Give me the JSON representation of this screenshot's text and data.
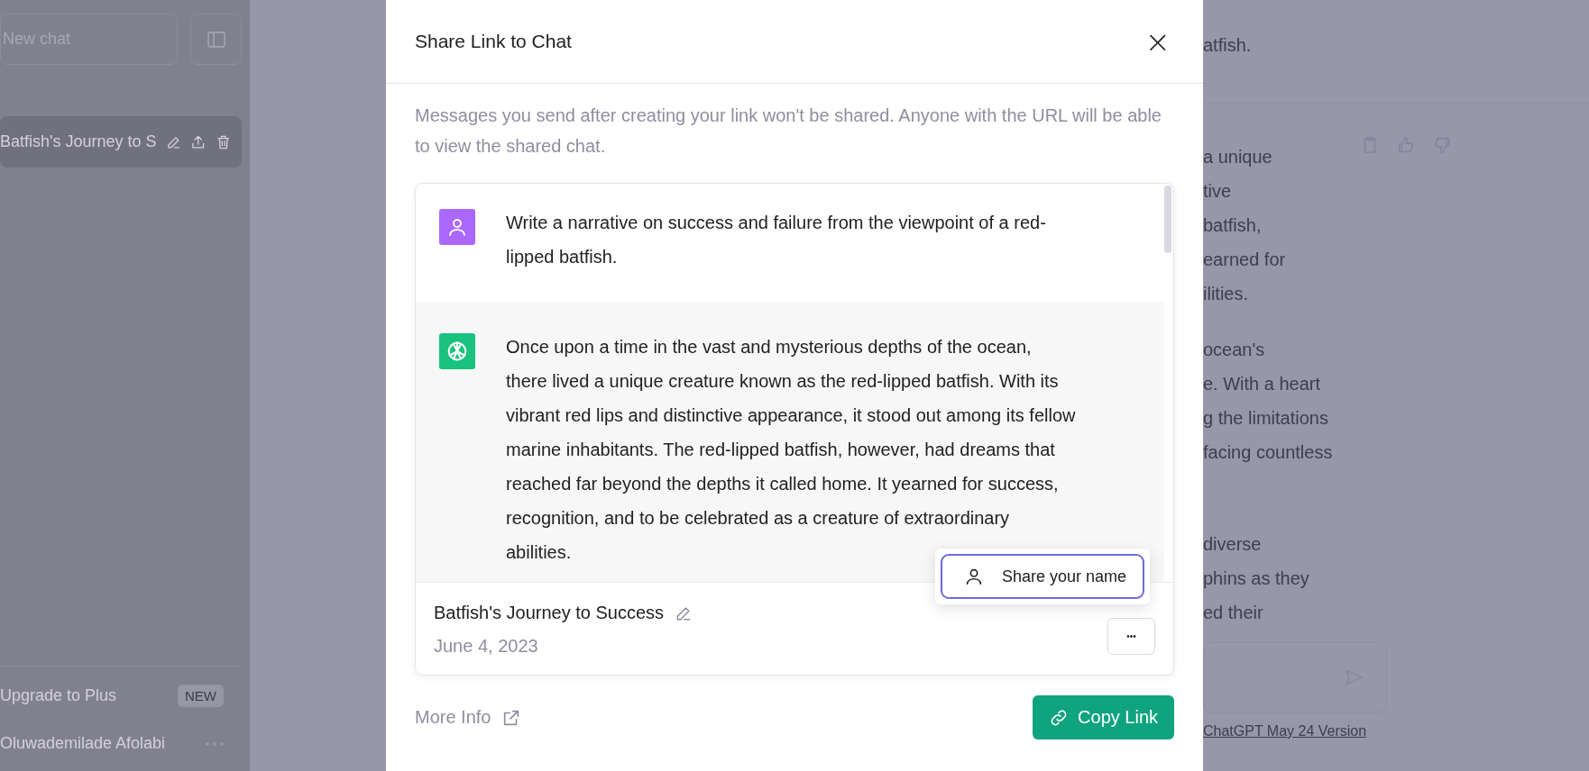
{
  "sidebar": {
    "new_chat_button": "New chat",
    "conversations": [
      {
        "title": "Batfish's Journey to S",
        "selected": true
      }
    ],
    "upgrade": {
      "label": "Upgrade to Plus",
      "badge": "NEW"
    },
    "user": {
      "name": "Oluwademilade Afolabi"
    }
  },
  "background_chat": {
    "paragraphs": [
      [
        "atfish."
      ],
      [
        "a unique",
        "tive",
        "batfish,",
        "earned for",
        "ilities."
      ],
      [
        "ocean's",
        "e. With a heart",
        "g the limitations",
        "facing countless"
      ],
      [
        "diverse",
        "phins as they",
        "ed their"
      ]
    ],
    "footer_link": "ChatGPT May 24 Version"
  },
  "dialog": {
    "title": "Share Link to Chat",
    "close": "×",
    "description": "Messages you send after creating your link won't be shared. Anyone with the URL will be able to view the shared chat.",
    "messages": [
      {
        "kind": "user",
        "text": "Write a narrative on success and failure from the viewpoint of a red-lipped batfish."
      },
      {
        "kind": "assistant",
        "text": "Once upon a time in the vast and mysterious depths of the ocean, there lived a unique creature known as the red-lipped batfish. With its vibrant red lips and distinctive appearance, it stood out among its fellow marine inhabitants. The red-lipped batfish, however, had dreams that reached far beyond the depths it called home. It yearned for success, recognition, and to be celebrated as a creature of extraordinary abilities."
      }
    ],
    "chat_title": "Batfish's Journey to Success",
    "date": "June 4, 2023",
    "more_button": "•••",
    "popover": {
      "label": "Share your name"
    },
    "more_info": "More Info",
    "copy_link": "Copy Link"
  }
}
